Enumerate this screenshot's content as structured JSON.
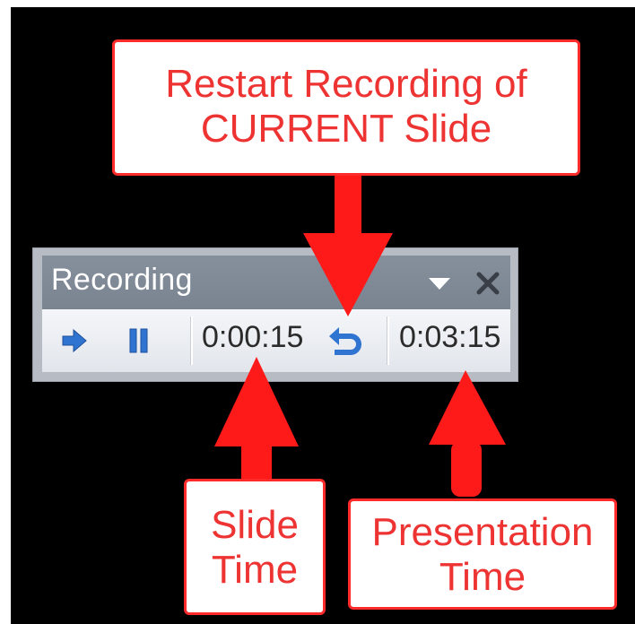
{
  "toolbar": {
    "title": "Recording",
    "slide_time": "0:00:15",
    "presentation_time": "0:03:15",
    "icons": {
      "next": "next-slide-arrow-icon",
      "pause": "pause-icon",
      "repeat": "repeat-icon",
      "dropdown": "dropdown-triangle-icon",
      "close": "close-x-icon"
    }
  },
  "callouts": {
    "restart": {
      "line1": "Restart Recording of",
      "line2": "CURRENT Slide"
    },
    "slide_time": {
      "line1": "Slide",
      "line2": "Time"
    },
    "presentation_time": {
      "line1": "Presentation",
      "line2": "Time"
    }
  },
  "colors": {
    "background": "#000000",
    "callout_red": "#ff2a2a",
    "callout_text": "#ee3333",
    "icon_blue": "#2f74d0"
  }
}
